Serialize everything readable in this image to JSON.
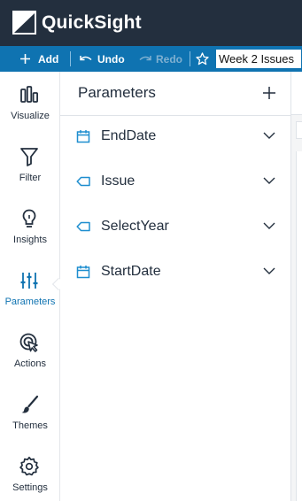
{
  "app": {
    "brand": "QuickSight",
    "colors": {
      "header": "#232f3e",
      "toolbar": "#0f73b1",
      "accent": "#0f73b1",
      "text": "#232f3e"
    }
  },
  "toolbar": {
    "add_icon": "plus-icon",
    "add_label": "Add",
    "undo_icon": "undo-icon",
    "undo_label": "Undo",
    "redo_icon": "redo-icon",
    "redo_label": "Redo",
    "favorite_icon": "star-icon",
    "analysis_title": "Week 2 Issues"
  },
  "rail": {
    "items": [
      {
        "label": "Visualize",
        "icon": "bar-chart-icon"
      },
      {
        "label": "Filter",
        "icon": "funnel-icon"
      },
      {
        "label": "Insights",
        "icon": "lightbulb-icon"
      },
      {
        "label": "Parameters",
        "icon": "sliders-icon",
        "active": true
      },
      {
        "label": "Actions",
        "icon": "cursor-click-icon"
      },
      {
        "label": "Themes",
        "icon": "paintbrush-icon"
      },
      {
        "label": "Settings",
        "icon": "gear-icon"
      }
    ]
  },
  "panel": {
    "title": "Parameters",
    "add_icon": "plus-icon",
    "parameters": [
      {
        "name": "EndDate",
        "icon": "calendar-icon"
      },
      {
        "name": "Issue",
        "icon": "tag-icon"
      },
      {
        "name": "SelectYear",
        "icon": "tag-icon"
      },
      {
        "name": "StartDate",
        "icon": "calendar-icon"
      }
    ]
  }
}
